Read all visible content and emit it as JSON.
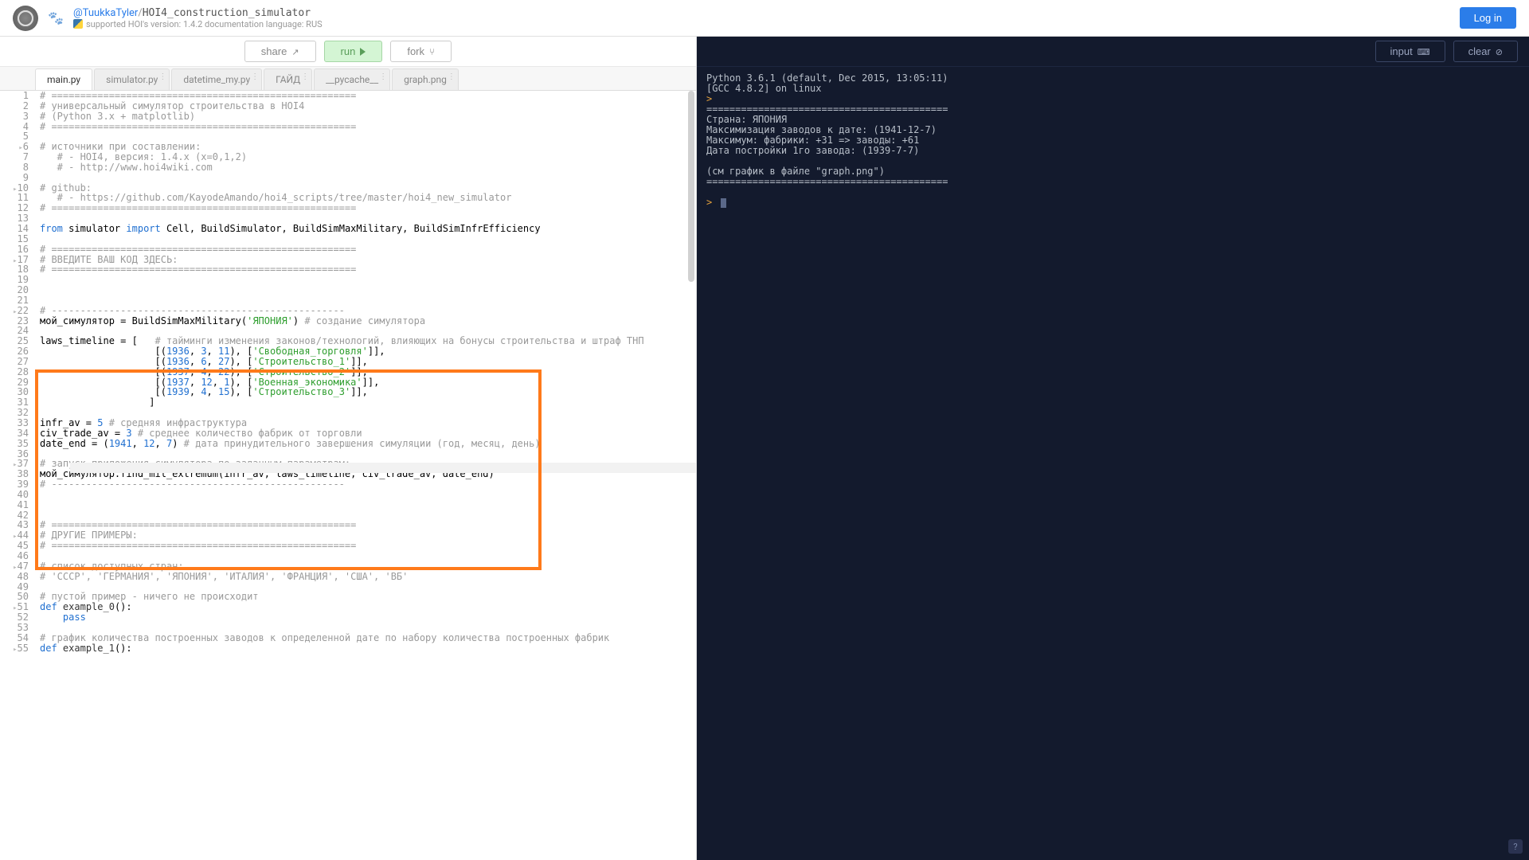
{
  "header": {
    "user": "@TuukkaTyler",
    "project": "HOI4_construction_simulator",
    "subtitle": "supported HOI's version: 1.4.2 documentation language: RUS",
    "login": "Log in"
  },
  "toolbar": {
    "share": "share",
    "run": "run",
    "fork": "fork"
  },
  "tabs": [
    "main.py",
    "simulator.py",
    "datetime_my.py",
    "ГАЙД",
    "__pycache__",
    "graph.png"
  ],
  "right_toolbar": {
    "input": "input",
    "clear": "clear"
  },
  "console": {
    "lines": [
      "Python 3.6.1 (default, Dec 2015, 13:05:11)",
      "[GCC 4.8.2] on linux",
      "",
      "==========================================",
      "Страна: ЯПОНИЯ",
      "Максимизация заводов к дате: (1941-12-7)",
      "Максимум: фабрики: +31 => заводы: +61",
      "Дата постройки 1го завода: (1939-7-7)",
      "",
      "(см график в файле \"graph.png\")",
      "=========================================="
    ]
  },
  "code": [
    {
      "n": 1,
      "t": "# =====================================================",
      "cls": "c-comment"
    },
    {
      "n": 2,
      "t": "# универсальный симулятор строительства в HOI4",
      "cls": "c-comment"
    },
    {
      "n": 3,
      "t": "# (Python 3.x + matplotlib)",
      "cls": "c-comment"
    },
    {
      "n": 4,
      "t": "# =====================================================",
      "cls": "c-comment"
    },
    {
      "n": 5,
      "t": "",
      "cls": ""
    },
    {
      "n": 6,
      "t": "# источники при составлении:",
      "cls": "c-comment",
      "fold": true
    },
    {
      "n": 7,
      "t": "   # - HOI4, версия: 1.4.x (x=0,1,2)",
      "cls": "c-comment"
    },
    {
      "n": 8,
      "t": "   # - http://www.hoi4wiki.com",
      "cls": "c-comment"
    },
    {
      "n": 9,
      "t": "",
      "cls": ""
    },
    {
      "n": 10,
      "t": "# github:",
      "cls": "c-comment",
      "fold": true
    },
    {
      "n": 11,
      "t": "   # - https://github.com/KayodeAmando/hoi4_scripts/tree/master/hoi4_new_simulator",
      "cls": "c-comment"
    },
    {
      "n": 12,
      "t": "# =====================================================",
      "cls": "c-comment"
    },
    {
      "n": 13,
      "t": "",
      "cls": ""
    },
    {
      "n": 14,
      "html": "<span class='c-kw'>from</span> simulator <span class='c-kw'>import</span> Cell, BuildSimulator, BuildSimMaxMilitary, BuildSimInfrEfficiency"
    },
    {
      "n": 15,
      "t": "",
      "cls": ""
    },
    {
      "n": 16,
      "t": "# =====================================================",
      "cls": "c-comment"
    },
    {
      "n": 17,
      "t": "# ВВЕДИТЕ ВАШ КОД ЗДЕСЬ:",
      "cls": "c-comment",
      "fold": true
    },
    {
      "n": 18,
      "t": "# =====================================================",
      "cls": "c-comment"
    },
    {
      "n": 19,
      "t": "",
      "cls": ""
    },
    {
      "n": 20,
      "t": "",
      "cls": ""
    },
    {
      "n": 21,
      "t": "",
      "cls": ""
    },
    {
      "n": 22,
      "t": "# ---------------------------------------------------",
      "cls": "c-comment",
      "fold": true
    },
    {
      "n": 23,
      "html": "мой_симулятор = BuildSimMaxMilitary(<span class='c-str'>'ЯПОНИЯ'</span>) <span class='c-comment'># создание симулятора</span>"
    },
    {
      "n": 24,
      "t": "",
      "cls": ""
    },
    {
      "n": 25,
      "html": "laws_timeline = [   <span class='c-comment'># тайминги изменения законов/технологий, влияющих на бонусы строительства и штраф ТНП</span>"
    },
    {
      "n": 26,
      "html": "                    [(<span class='c-num'>1936</span>, <span class='c-num'>3</span>, <span class='c-num'>11</span>), [<span class='c-str'>'Свободная_торговля'</span>]],"
    },
    {
      "n": 27,
      "html": "                    [(<span class='c-num'>1936</span>, <span class='c-num'>6</span>, <span class='c-num'>27</span>), [<span class='c-str'>'Строительство_1'</span>]],"
    },
    {
      "n": 28,
      "html": "                    [(<span class='c-num'>1937</span>, <span class='c-num'>4</span>, <span class='c-num'>22</span>), [<span class='c-str'>'Строительство_2'</span>]],"
    },
    {
      "n": 29,
      "html": "                    [(<span class='c-num'>1937</span>, <span class='c-num'>12</span>, <span class='c-num'>1</span>), [<span class='c-str'>'Военная_экономика'</span>]],"
    },
    {
      "n": 30,
      "html": "                    [(<span class='c-num'>1939</span>, <span class='c-num'>4</span>, <span class='c-num'>15</span>), [<span class='c-str'>'Строительство_3'</span>]],"
    },
    {
      "n": 31,
      "t": "                   ]",
      "cls": ""
    },
    {
      "n": 32,
      "t": "",
      "cls": ""
    },
    {
      "n": 33,
      "html": "infr_av = <span class='c-num'>5</span> <span class='c-comment'># средняя инфраструктура</span>"
    },
    {
      "n": 34,
      "html": "civ_trade_av = <span class='c-num'>3</span> <span class='c-comment'># среднее количество фабрик от торговли</span>"
    },
    {
      "n": 35,
      "html": "date_end = (<span class='c-num'>1941</span>, <span class='c-num'>12</span>, <span class='c-num'>7</span>) <span class='c-comment'># дата принудительного завершения симуляции (год, месяц, день)</span>"
    },
    {
      "n": 36,
      "t": "",
      "cls": ""
    },
    {
      "n": 37,
      "t": "# запуск приложения симулятора по заданным параметрам:",
      "cls": "c-comment",
      "fold": true
    },
    {
      "n": 38,
      "html": "мой_симулятор.find_mil_extremum(infr_av, laws_timeline, civ_trade_av, date_end)"
    },
    {
      "n": 39,
      "t": "# ---------------------------------------------------",
      "cls": "c-comment"
    },
    {
      "n": 40,
      "t": "",
      "cls": ""
    },
    {
      "n": 41,
      "t": "",
      "cls": ""
    },
    {
      "n": 42,
      "t": "",
      "cls": ""
    },
    {
      "n": 43,
      "t": "# =====================================================",
      "cls": "c-comment"
    },
    {
      "n": 44,
      "t": "# ДРУГИЕ ПРИМЕРЫ:",
      "cls": "c-comment",
      "fold": true
    },
    {
      "n": 45,
      "t": "# =====================================================",
      "cls": "c-comment"
    },
    {
      "n": 46,
      "t": "",
      "cls": ""
    },
    {
      "n": 47,
      "t": "# список доступных стран:",
      "cls": "c-comment",
      "fold": true
    },
    {
      "n": 48,
      "html": "<span class='c-comment'># 'СССР', 'ГЕРМАНИЯ', 'ЯПОНИЯ', 'ИТАЛИЯ', 'ФРАНЦИЯ', 'США', 'ВБ'</span>"
    },
    {
      "n": 49,
      "t": "",
      "cls": ""
    },
    {
      "n": 50,
      "t": "# пустой пример - ничего не происходит",
      "cls": "c-comment"
    },
    {
      "n": 51,
      "html": "<span class='c-kw'>def</span> <span class='c-fn'>example_0</span>():",
      "fold": true
    },
    {
      "n": 52,
      "html": "    <span class='c-kw'>pass</span>"
    },
    {
      "n": 53,
      "t": "",
      "cls": ""
    },
    {
      "n": 54,
      "t": "# график количества построенных заводов к определенной дате по набору количества построенных фабрик",
      "cls": "c-comment"
    },
    {
      "n": 55,
      "html": "<span class='c-kw'>def</span> <span class='c-fn'>example_1</span>():",
      "fold": true
    }
  ]
}
